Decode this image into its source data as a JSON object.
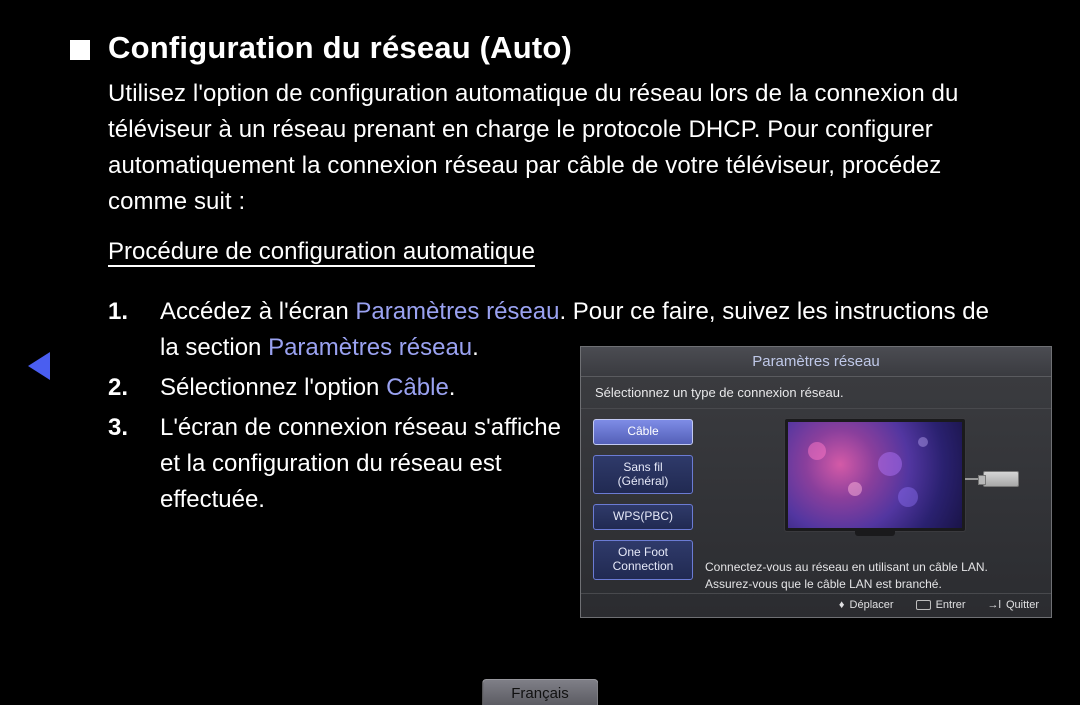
{
  "title": "Configuration du réseau (Auto)",
  "intro": "Utilisez l'option de configuration automatique du réseau lors de la connexion du téléviseur à un réseau prenant en charge le protocole DHCP. Pour configurer automatiquement la connexion réseau par câble de votre téléviseur, procédez comme suit :",
  "subtitle": "Procédure de configuration automatique",
  "steps": {
    "step1": {
      "num": "1.",
      "pre": "Accédez à l'écran ",
      "hl1": "Paramètres réseau",
      "mid": ". Pour ce faire, suivez les instructions de la section ",
      "hl2": "Paramètres réseau",
      "post": "."
    },
    "step2": {
      "num": "2.",
      "pre": "Sélectionnez l'option ",
      "hl": "Câble",
      "post": "."
    },
    "step3": {
      "num": "3.",
      "text": "L'écran de connexion réseau s'affiche et la configuration du réseau est effectuée."
    }
  },
  "panel": {
    "header": "Paramètres réseau",
    "sub": "Sélectionnez un type de connexion réseau.",
    "options": {
      "cable": "Câble",
      "wifi_line1": "Sans fil",
      "wifi_line2": "(Général)",
      "wps": "WPS(PBC)",
      "onefoot_line1": "One Foot",
      "onefoot_line2": "Connection"
    },
    "desc": "Connectez-vous au réseau en utilisant un câble LAN. Assurez-vous que le câble LAN est branché.",
    "footer": {
      "move": "Déplacer",
      "enter": "Entrer",
      "quit": "Quitter"
    }
  },
  "lang": "Français"
}
